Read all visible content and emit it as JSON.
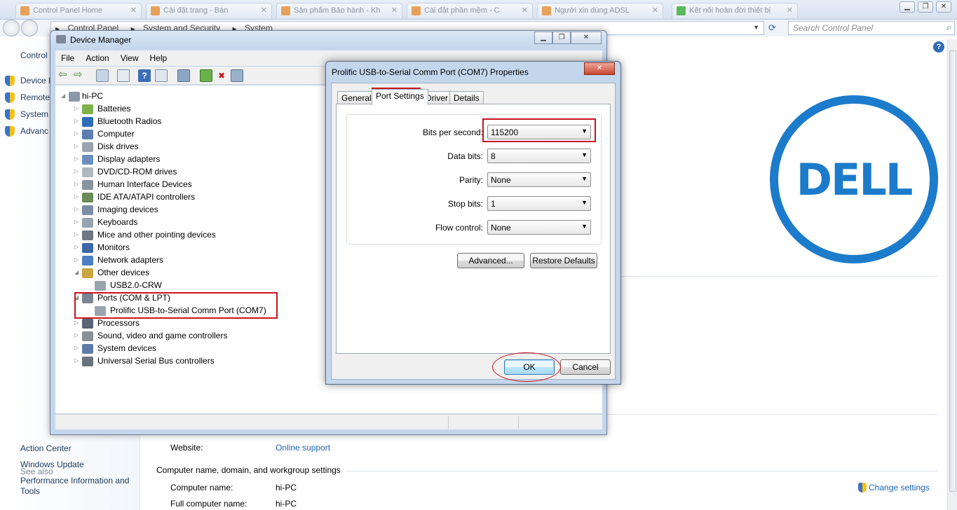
{
  "browser": {
    "tabs": [
      "Control Panel Home",
      "Cài đặt trang - Bàn",
      "Sản phẩm Bảo hành - Kh",
      "Cài đặt phần mềm - C",
      "Người xin dùng ADSL",
      "Kết nối hoàn đời thiết bị"
    ]
  },
  "explorer": {
    "breadcrumb": [
      "Control Panel",
      "System and Security",
      "System"
    ],
    "search_placeholder": "Search Control Panel"
  },
  "control_panel": {
    "left_links": [
      "Control",
      "Device M",
      "Remote",
      "System",
      "Advanc"
    ],
    "see_also": "See also",
    "see_also_links": [
      "Action Center",
      "Windows Update",
      "Performance Information and",
      "Tools"
    ],
    "website_label": "Website:",
    "website_link": "Online support",
    "section_title": "Computer name, domain, and workgroup settings",
    "computer_name_label": "Computer name:",
    "computer_name_value": "hi-PC",
    "full_name_label": "Full computer name:",
    "full_name_value": "hi-PC",
    "change_settings": "Change settings",
    "logo_text": "DELL"
  },
  "device_manager": {
    "title": "Device Manager",
    "menu": [
      "File",
      "Action",
      "View",
      "Help"
    ],
    "root": "hi-PC",
    "nodes": [
      {
        "label": "Batteries",
        "expanded": false
      },
      {
        "label": "Bluetooth Radios",
        "expanded": false
      },
      {
        "label": "Computer",
        "expanded": false
      },
      {
        "label": "Disk drives",
        "expanded": false
      },
      {
        "label": "Display adapters",
        "expanded": false
      },
      {
        "label": "DVD/CD-ROM drives",
        "expanded": false
      },
      {
        "label": "Human Interface Devices",
        "expanded": false
      },
      {
        "label": "IDE ATA/ATAPI controllers",
        "expanded": false
      },
      {
        "label": "Imaging devices",
        "expanded": false
      },
      {
        "label": "Keyboards",
        "expanded": false
      },
      {
        "label": "Mice and other pointing devices",
        "expanded": false
      },
      {
        "label": "Monitors",
        "expanded": false
      },
      {
        "label": "Network adapters",
        "expanded": false
      },
      {
        "label": "Other devices",
        "expanded": true
      },
      {
        "label": "USB2.0-CRW",
        "child": true
      },
      {
        "label": "Ports (COM & LPT)",
        "expanded": true
      },
      {
        "label": "Prolific USB-to-Serial Comm Port (COM7)",
        "child": true
      },
      {
        "label": "Processors",
        "expanded": false
      },
      {
        "label": "Sound, video and game controllers",
        "expanded": false
      },
      {
        "label": "System devices",
        "expanded": false
      },
      {
        "label": "Universal Serial Bus controllers",
        "expanded": false
      }
    ]
  },
  "dialog": {
    "title": "Prolific USB-to-Serial Comm Port (COM7) Properties",
    "tabs": [
      "General",
      "Port Settings",
      "Driver",
      "Details"
    ],
    "active_tab": "Port Settings",
    "fields": [
      {
        "label": "Bits per second:",
        "value": "115200"
      },
      {
        "label": "Data bits:",
        "value": "8"
      },
      {
        "label": "Parity:",
        "value": "None"
      },
      {
        "label": "Stop bits:",
        "value": "1"
      },
      {
        "label": "Flow control:",
        "value": "None"
      }
    ],
    "advanced_button": "Advanced...",
    "restore_button": "Restore Defaults",
    "ok_button": "OK",
    "cancel_button": "Cancel"
  },
  "colors": {
    "highlight_red": "#c8141c",
    "dell_blue": "#1c7ccb",
    "link_blue": "#1a65b5"
  }
}
